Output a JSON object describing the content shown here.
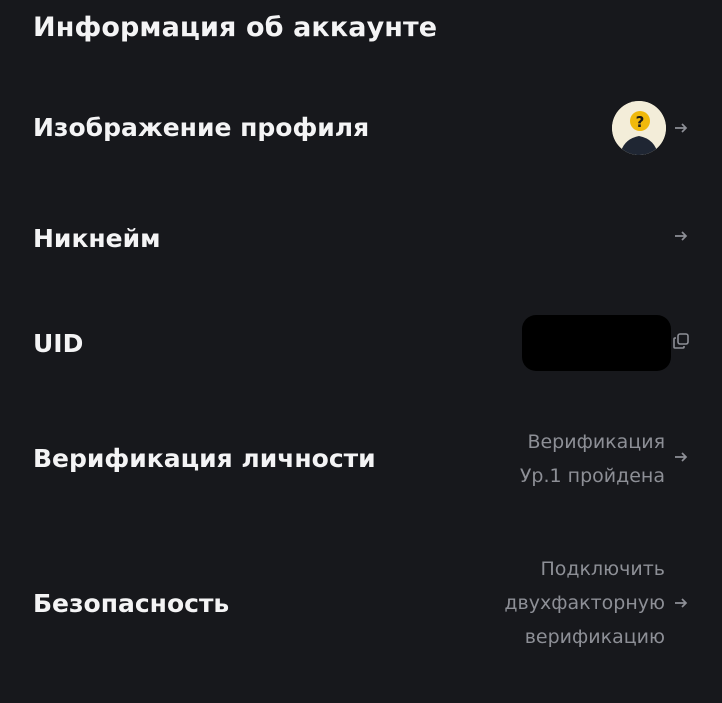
{
  "header": {
    "title": "Информация об аккаунте"
  },
  "rows": {
    "avatar": {
      "label": "Изображение профиля",
      "icon": "avatar-placeholder-question"
    },
    "nickname": {
      "label": "Никнейм"
    },
    "uid": {
      "label": "UID",
      "value_hidden": true,
      "icon": "copy-icon"
    },
    "identity": {
      "label": "Верификация личности",
      "status_line1": "Верификация",
      "status_line2": "Ур.1 пройдена"
    },
    "security": {
      "label": "Безопасность",
      "action_line1": "Подключить",
      "action_line2": "двухфакторную",
      "action_line3": "верификацию"
    }
  },
  "colors": {
    "background": "#17181c",
    "text_primary": "#f4f4f5",
    "text_secondary": "#8d8f96",
    "avatar_bg": "#f3edd9",
    "avatar_badge": "#f0b90b"
  },
  "icons": {
    "arrow": "arrow-right-icon",
    "copy": "copy-icon"
  }
}
